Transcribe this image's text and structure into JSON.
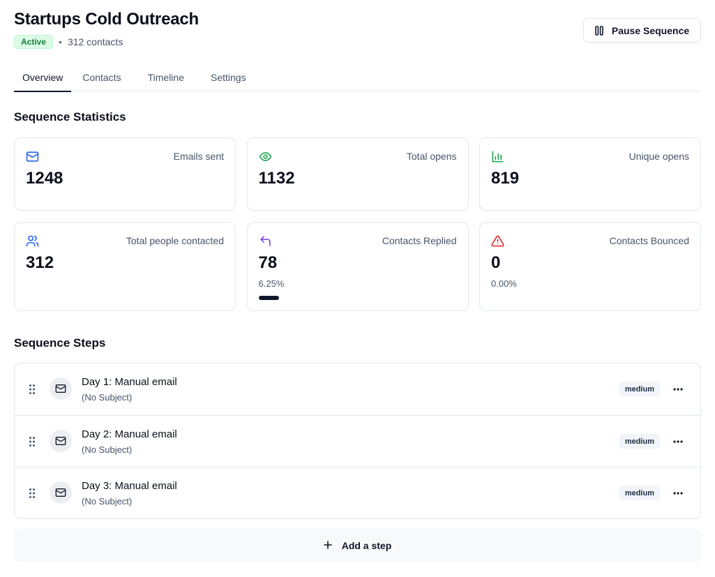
{
  "header": {
    "title": "Startups Cold Outreach",
    "status_badge": "Active",
    "separator": "•",
    "contacts_count": "312 contacts",
    "pause_button_label": "Pause Sequence"
  },
  "tabs": [
    {
      "label": "Overview",
      "active": true
    },
    {
      "label": "Contacts",
      "active": false
    },
    {
      "label": "Timeline",
      "active": false
    },
    {
      "label": "Settings",
      "active": false
    }
  ],
  "stats": {
    "section_title": "Sequence Statistics",
    "cards": [
      {
        "icon": "mail-icon",
        "icon_color": "#2563eb",
        "label": "Emails sent",
        "value": "1248"
      },
      {
        "icon": "eye-icon",
        "icon_color": "#16a34a",
        "label": "Total opens",
        "value": "1132"
      },
      {
        "icon": "bar-chart-icon",
        "icon_color": "#16a34a",
        "label": "Unique opens",
        "value": "819"
      },
      {
        "icon": "users-icon",
        "icon_color": "#2563eb",
        "label": "Total people contacted",
        "value": "312"
      },
      {
        "icon": "reply-icon",
        "icon_color": "#7c3aed",
        "label": "Contacts Replied",
        "value": "78",
        "sub": "6.25%",
        "progress": 0.0625
      },
      {
        "icon": "alert-triangle-icon",
        "icon_color": "#dc2626",
        "label": "Contacts Bounced",
        "value": "0",
        "sub": "0.00%"
      }
    ]
  },
  "steps": {
    "section_title": "Sequence Steps",
    "items": [
      {
        "title": "Day 1: Manual email",
        "subject": "(No Subject)",
        "priority": "medium"
      },
      {
        "title": "Day 2: Manual email",
        "subject": "(No Subject)",
        "priority": "medium"
      },
      {
        "title": "Day 3: Manual email",
        "subject": "(No Subject)",
        "priority": "medium"
      }
    ],
    "add_label": "Add a step"
  }
}
